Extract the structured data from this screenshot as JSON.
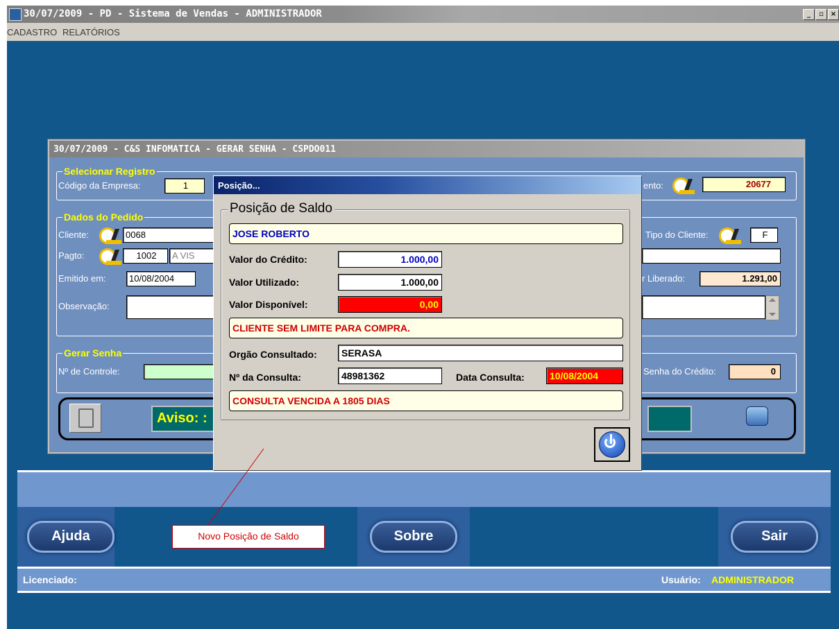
{
  "window": {
    "title": "30/07/2009 - PD - Sistema de Vendas - ADMINISTRADOR",
    "minimize": "_",
    "restore": "▫",
    "close": "×"
  },
  "menu": [
    "CADASTRO",
    "RELATÓRIOS"
  ],
  "form": {
    "title": "30/07/2009 - C&S INFOMATICA - GERAR SENHA - CSPDO011",
    "selecionar": {
      "title": "Selecionar Registro",
      "codigo_label": "Código da Empresa:",
      "codigo_value": "1",
      "atendimento_label": "ento:",
      "atendimento_value": "20677"
    },
    "pedido": {
      "title": "Dados do Pedido",
      "cliente_label": "Cliente:",
      "cliente_value": "0068",
      "tipo_label": "Tipo do Cliente:",
      "tipo_value": "F",
      "pagto_label": "Pagto:",
      "pagto_code": "1002",
      "pagto_desc": "A VIS",
      "emitido_label": "Emitido em:",
      "emitido_value": "10/08/2004",
      "liberado_label": "r Liberado:",
      "liberado_value": "1.291,00",
      "obs_label": "Observação:"
    },
    "senha": {
      "title": "Gerar Senha",
      "controle_label": "Nº de Controle:",
      "senha_label": "Senha do Crédito:",
      "senha_value": "0"
    },
    "aviso": "Aviso: :"
  },
  "dialog": {
    "title": "Posição...",
    "group_title": "Posição de Saldo",
    "cliente": "JOSE ROBERTO",
    "credito_label": "Valor do Crédito:",
    "credito_value": "1.000,00",
    "utilizado_label": "Valor Utilizado:",
    "utilizado_value": "1.000,00",
    "disponivel_label": "Valor Disponível:",
    "disponivel_value": "0,00",
    "limite_msg": "CLIENTE SEM LIMITE PARA COMPRA.",
    "orgao_label": "Orgão Consultado:",
    "orgao_value": "SERASA",
    "consulta_label": "Nº da Consulta:",
    "consulta_value": "48981362",
    "data_label": "Data Consulta:",
    "data_value": "10/08/2004",
    "vencida_msg": "CONSULTA VENCIDA A 1805 DIAS"
  },
  "bottom": {
    "ajuda": "Ajuda",
    "sobre": "Sobre",
    "sair": "Sair",
    "licenciado_label": "Licenciado:",
    "usuario_label": "Usuário:",
    "usuario_value": "ADMINISTRADOR"
  },
  "annotation": "Novo Posição de Saldo",
  "colors": {
    "desktop": "#12578c",
    "panel": "#6f8fbf",
    "group_title": "#ffff00",
    "alert_red": "#d00000",
    "disponivel_bg": "#ff0000"
  }
}
